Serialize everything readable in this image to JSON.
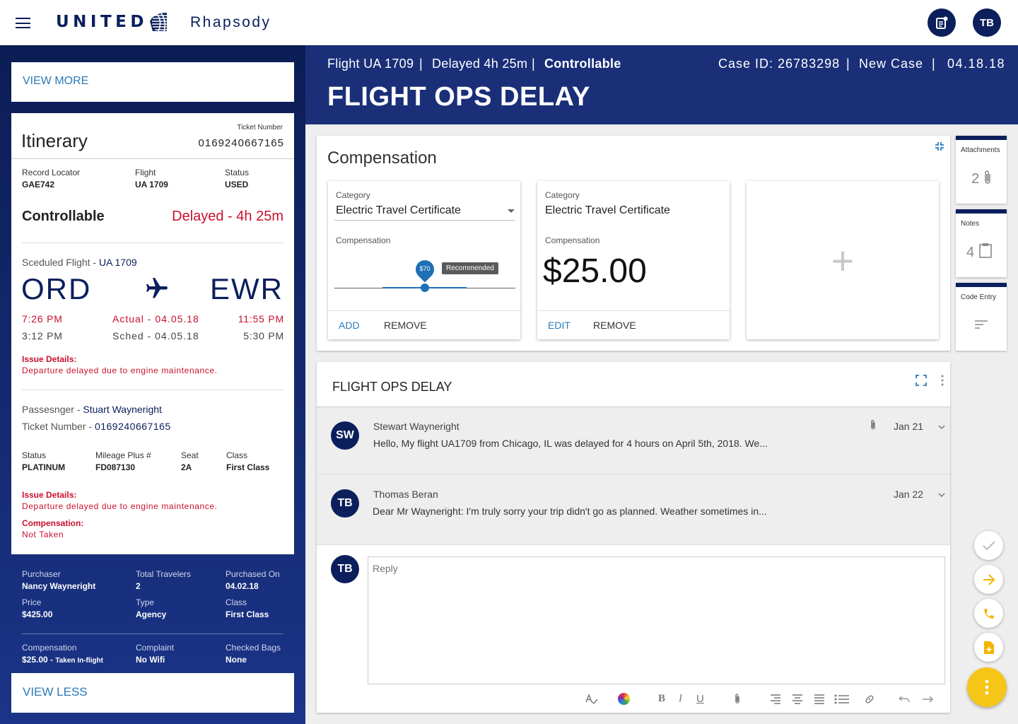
{
  "app": {
    "brand": "UNITED",
    "name": "Rhapsody",
    "user_initials": "TB"
  },
  "view_more": "VIEW MORE",
  "view_less": "VIEW LESS",
  "itinerary": {
    "title": "Itinerary",
    "ticket_label": "Ticket Number",
    "ticket_number": "0169240667165",
    "record_locator_label": "Record Locator",
    "record_locator": "GAE742",
    "flight_label": "Flight",
    "flight": "UA 1709",
    "status_label": "Status",
    "status": "USED",
    "controllable": "Controllable",
    "delay": "Delayed - 4h 25m",
    "scheduled_label": "Sceduled Flight - ",
    "scheduled_flight": "UA 1709",
    "origin": "ORD",
    "destination": "EWR",
    "dep_actual": "7:26 PM",
    "arr_actual": "11:55 PM",
    "actual_date": "Actual - 04.05.18",
    "dep_sched": "3:12 PM",
    "arr_sched": "5:30 PM",
    "sched_date": "Sched - 04.05.18",
    "issue_label": "Issue Details:",
    "issue_text": "Departure delayed due to engine maintenance."
  },
  "passenger": {
    "name_label": "Passesnger - ",
    "name": "Stuart Wayneright",
    "ticket_label": "Ticket Number - ",
    "ticket": "0169240667165",
    "status_label": "Status",
    "status": "PLATINUM",
    "mileage_label": "Mileage Plus #",
    "mileage": "FD087130",
    "seat_label": "Seat",
    "seat": "2A",
    "class_label": "Class",
    "class": "First Class",
    "issue_label": "Issue Details:",
    "issue_text": "Departure delayed due to engine maintenance.",
    "comp_label": "Compensation:",
    "comp_text": "Not Taken"
  },
  "purchase": {
    "purchaser_label": "Purchaser",
    "purchaser": "Nancy Wayneright",
    "travelers_label": "Total Travelers",
    "travelers": "2",
    "purchased_label": "Purchased On",
    "purchased": "04.02.18",
    "price_label": "Price",
    "price": "$425.00",
    "type_label": "Type",
    "type": "Agency",
    "class_label": "Class",
    "class": "First Class",
    "comp_label": "Compensation",
    "comp": "$25.00 - ",
    "comp_note": "Taken In-flight",
    "complaint_label": "Complaint",
    "complaint": "No Wifi",
    "bags_label": "Checked Bags",
    "bags": "None"
  },
  "header": {
    "flight": "Flight UA 1709",
    "delay": "Delayed 4h 25m",
    "controllable": "Controllable",
    "case_id": "Case ID: 26783298",
    "case_status": "New Case",
    "date": "04.18.18",
    "sep": "|",
    "title": "FLIGHT OPS DELAY"
  },
  "compensation": {
    "title": "Compensation",
    "card1": {
      "category_label": "Category",
      "category": "Electric Travel Certificate",
      "comp_label": "Compensation",
      "slider_value": "$70",
      "slider_badge": "Recommended",
      "slider_fraction": 0.5,
      "add": "ADD",
      "remove": "REMOVE"
    },
    "card2": {
      "category_label": "Category",
      "category": "Electric Travel Certificate",
      "comp_label": "Compensation",
      "amount": "$25.00",
      "edit": "EDIT",
      "remove": "REMOVE"
    },
    "add_symbol": "+"
  },
  "side_tabs": {
    "attachments": "Attachments",
    "attachments_count": "2",
    "notes": "Notes",
    "notes_count": "4",
    "code_entry": "Code Entry"
  },
  "thread": {
    "title": "FLIGHT OPS DELAY",
    "messages": [
      {
        "initials": "SW",
        "author": "Stewart Wayneright",
        "date": "Jan 21",
        "text": "Hello, My flight UA1709 from Chicago, IL was delayed for 4 hours on April 5th, 2018. We..."
      },
      {
        "initials": "TB",
        "author": "Thomas Beran",
        "date": "Jan 22",
        "text": "Dear Mr Wayneright: I'm truly sorry your trip didn't go as planned. Weather sometimes in..."
      }
    ],
    "reply_placeholder": "Reply",
    "reply_initials": "TB"
  },
  "colors": {
    "navy": "#0b1f5c",
    "red": "#c8102e",
    "link": "#2a7ab8",
    "fab_yellow": "#f5c518"
  }
}
